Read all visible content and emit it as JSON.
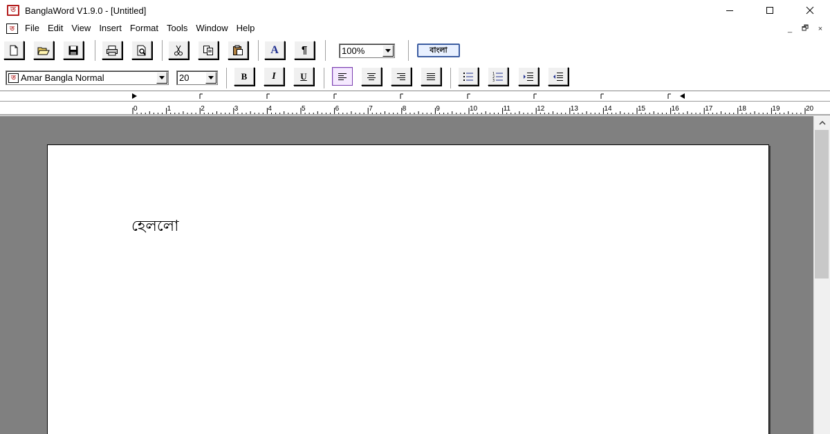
{
  "window": {
    "title": "BanglaWord V1.9.0 - [Untitled]",
    "app_icon_glyph": "ত",
    "controls": [
      "minimize-icon",
      "maximize-icon",
      "close-icon"
    ]
  },
  "menu": {
    "icon_glyph": "ত",
    "items": [
      "File",
      "Edit",
      "View",
      "Insert",
      "Format",
      "Tools",
      "Window",
      "Help"
    ],
    "mdi_controls": [
      "_",
      "🗗",
      "×"
    ]
  },
  "toolbar_main": {
    "buttons": [
      "new-document-icon",
      "open-folder-icon",
      "save-icon",
      "print-icon",
      "print-preview-icon",
      "cut-icon",
      "copy-icon",
      "paste-icon",
      "font-color-icon",
      "paragraph-mark-icon"
    ],
    "font_color_glyph": "A",
    "paragraph_glyph": "¶",
    "zoom_value": "100%",
    "language_label": "বাংলা"
  },
  "toolbar_format": {
    "font_icon_glyph": "ত",
    "font_name": "Amar Bangla Normal",
    "font_size": "20",
    "bold_label": "B",
    "italic_label": "I",
    "underline_label": "U",
    "alignment_buttons": [
      "align-left-icon",
      "align-center-icon",
      "align-right-icon",
      "align-justify-icon"
    ],
    "active_alignment": "align-left-icon",
    "list_buttons": [
      "bullet-list-icon",
      "numbered-list-icon",
      "increase-indent-icon",
      "decrease-indent-icon"
    ]
  },
  "ruler": {
    "labels": [
      "0",
      "1",
      "2",
      "3",
      "4",
      "5",
      "6",
      "7",
      "8",
      "9",
      "10",
      "11",
      "12",
      "13",
      "14",
      "15",
      "16",
      "17",
      "18",
      "19",
      "20"
    ]
  },
  "document": {
    "text": "হেললো"
  },
  "colors": {
    "workspace_bg": "#808080",
    "icon_red": "#b31c1c",
    "language_border": "#3a5ba0"
  }
}
